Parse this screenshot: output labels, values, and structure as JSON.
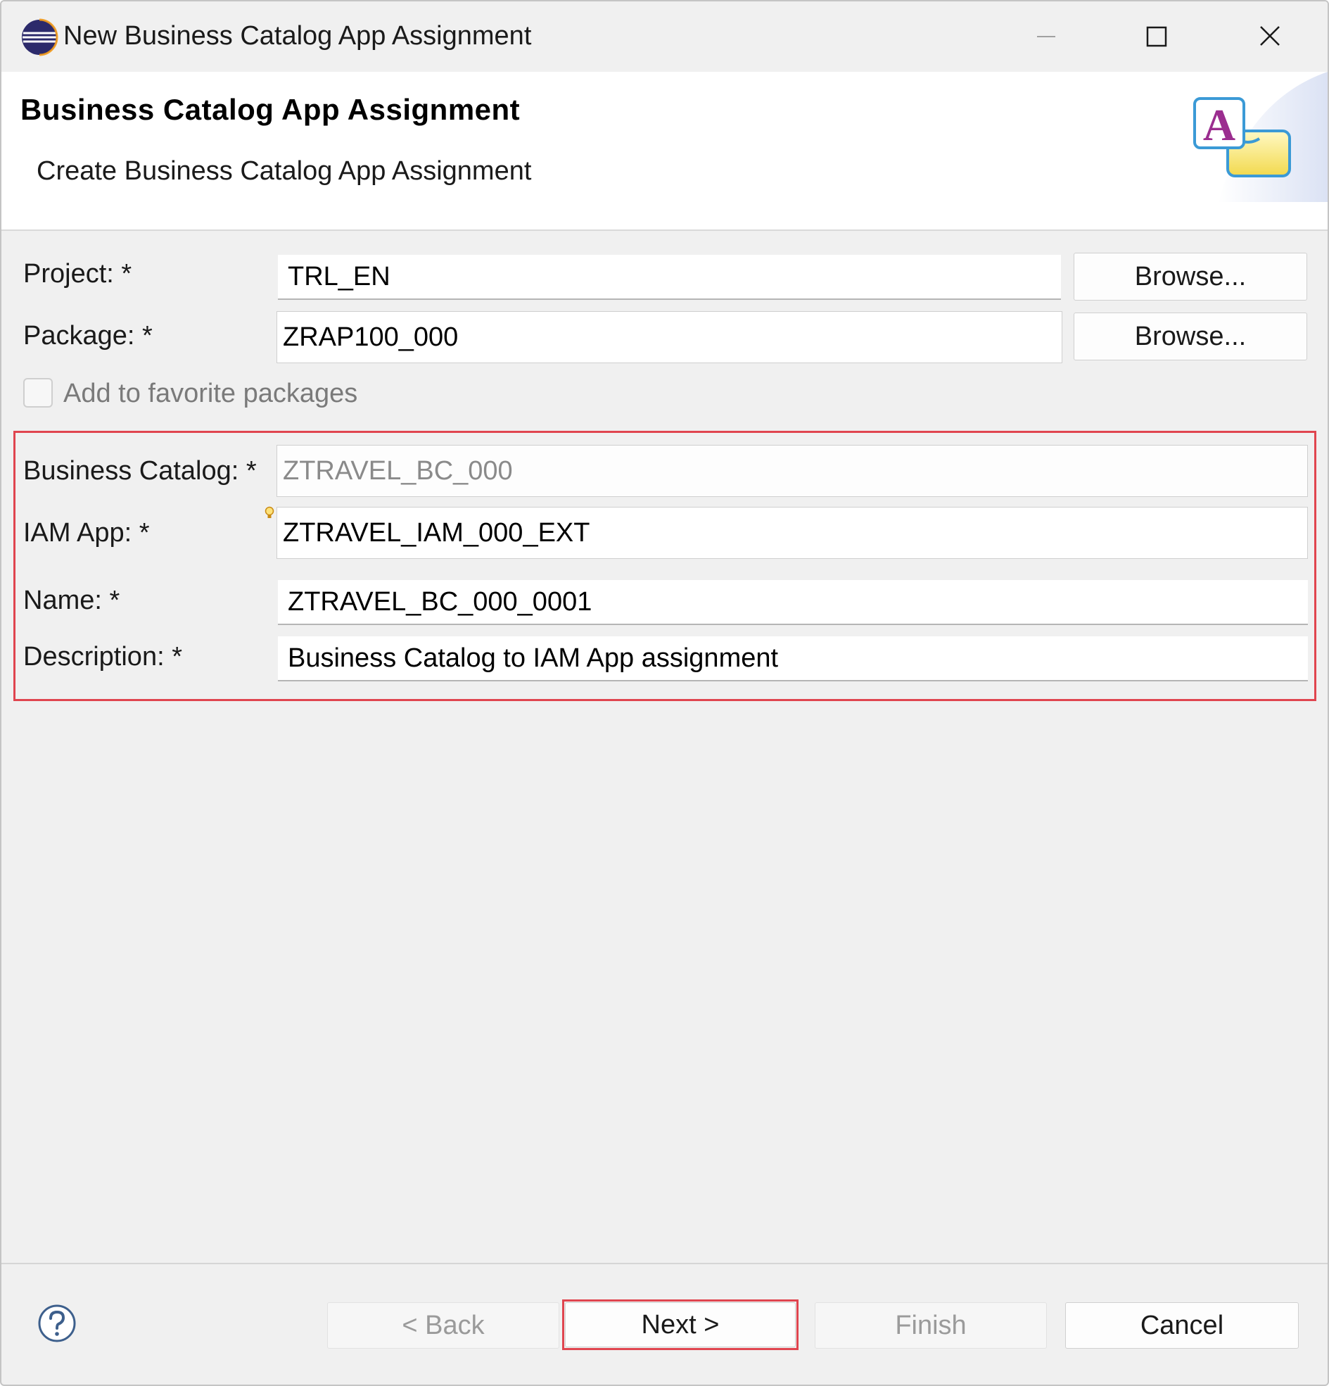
{
  "window": {
    "title": "New Business Catalog App Assignment",
    "controls": {
      "minimize": "minimize-icon",
      "maximize": "maximize-icon",
      "close": "close-icon"
    }
  },
  "banner": {
    "title": "Business Catalog App Assignment",
    "subtitle": "Create Business Catalog App Assignment",
    "icon": "abap-object-wizard-icon"
  },
  "form": {
    "project": {
      "label": "Project: *",
      "value": "TRL_EN",
      "browse": "Browse..."
    },
    "package": {
      "label": "Package: *",
      "value": "ZRAP100_000",
      "browse": "Browse..."
    },
    "favorite": {
      "label": "Add to favorite packages",
      "checked": false
    },
    "business_catalog": {
      "label": "Business Catalog: *",
      "value": "ZTRAVEL_BC_000"
    },
    "iam_app": {
      "label": "IAM App: *",
      "value": "ZTRAVEL_IAM_000_EXT"
    },
    "name": {
      "label": "Name: *",
      "value": "ZTRAVEL_BC_000_0001"
    },
    "description": {
      "label": "Description: *",
      "value": "Business Catalog to IAM App assignment"
    }
  },
  "footer": {
    "help_icon": "help-icon",
    "back": "< Back",
    "next": "Next >",
    "finish": "Finish",
    "cancel": "Cancel"
  },
  "colors": {
    "highlight": "#e0454f",
    "window_bg": "#f0f0f0",
    "banner_bg": "#ffffff"
  }
}
